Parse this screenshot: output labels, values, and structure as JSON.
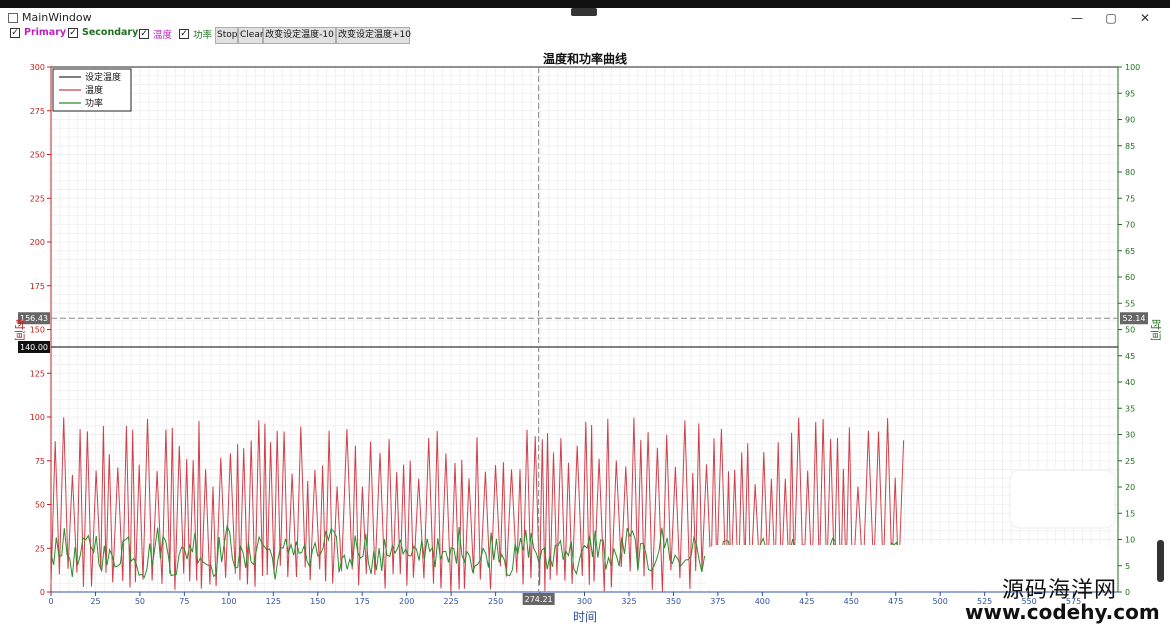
{
  "window": {
    "title": "MainWindow",
    "minimize": "—",
    "maximize": "▢",
    "close": "✕"
  },
  "toolbar": {
    "checkboxes": [
      {
        "label": "Primary",
        "checked": true,
        "color": "#c020c0"
      },
      {
        "label": "Secondary",
        "checked": true,
        "color": "#207020"
      },
      {
        "label": "温度",
        "checked": true,
        "color": "#c020c0"
      },
      {
        "label": "功率",
        "checked": true,
        "color": "#207020"
      }
    ],
    "buttons": [
      "Stop",
      "Clear",
      "改变设定温度-10",
      "改变设定温度+10"
    ]
  },
  "chart_data": {
    "type": "line",
    "title": "温度和功率曲线",
    "xlabel": "时间",
    "ylabel_left": "时间",
    "ylabel_right": "时间",
    "xlim": [
      0,
      600
    ],
    "ylim_left": [
      0,
      300
    ],
    "ylim_right": [
      0,
      100
    ],
    "x_ticks": [
      0,
      25,
      50,
      75,
      100,
      125,
      150,
      175,
      200,
      225,
      250,
      275,
      300,
      325,
      350,
      375,
      400,
      425,
      450,
      475,
      500,
      525,
      550,
      575
    ],
    "y_left_ticks": [
      0,
      25,
      50,
      75,
      100,
      125,
      150,
      175,
      200,
      225,
      250,
      275,
      300
    ],
    "y_right_ticks": [
      0,
      5,
      10,
      15,
      20,
      25,
      30,
      35,
      40,
      45,
      50,
      55,
      60,
      65,
      70,
      75,
      80,
      85,
      90,
      95,
      100
    ],
    "legend": [
      "设定温度",
      "温度",
      "功率"
    ],
    "legend_position": "top-left",
    "series_colors": {
      "设定温度": "#333333",
      "温度": "#d0404a",
      "功率": "#2e8b2e"
    },
    "set_temperature": 140.0,
    "crosshair": {
      "x_label": "274.21",
      "y_left_label": "156.43",
      "y_right_label": "52.14",
      "set_label": "140.00"
    },
    "temperature_range": [
      0,
      100
    ],
    "power_range": [
      0,
      30
    ],
    "x_end": 480
  },
  "watermark": {
    "cn": "源码海洋网",
    "url": "www.codehy.com"
  }
}
